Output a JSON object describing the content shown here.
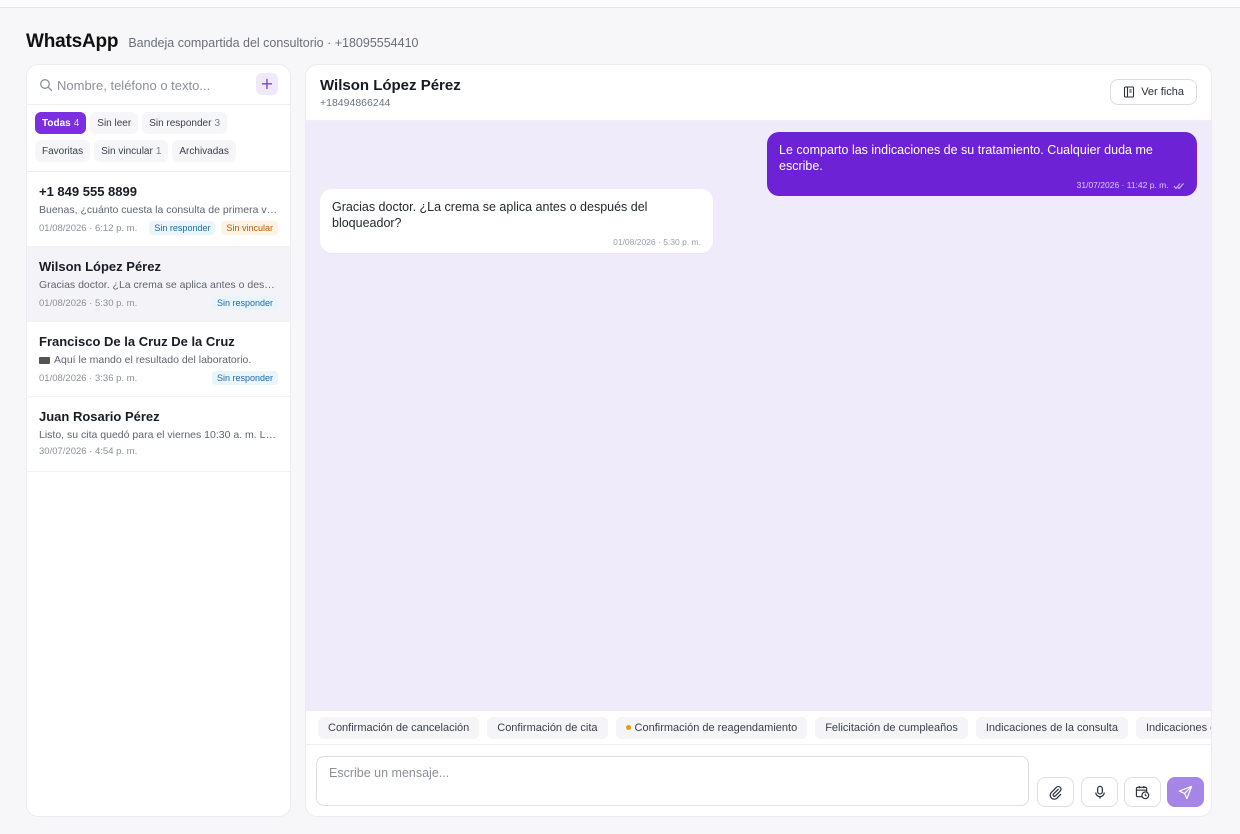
{
  "header": {
    "title": "WhatsApp",
    "subtitle": "Bandeja compartida del consultorio · +18095554410"
  },
  "sidebar": {
    "search_placeholder": "Nombre, teléfono o texto...",
    "add_label": "+",
    "filters": [
      {
        "label": "Todas",
        "count": "4",
        "active": true
      },
      {
        "label": "Sin leer",
        "count": ""
      },
      {
        "label": "Sin responder",
        "count": "3"
      },
      {
        "label": "Favoritas",
        "count": ""
      },
      {
        "label": "Sin vincular",
        "count": "1"
      },
      {
        "label": "Archivadas",
        "count": ""
      }
    ],
    "conversations": [
      {
        "name": "+1 849 555 8899",
        "preview": "Buenas, ¿cuánto cuesta la consulta de primera vez?",
        "time": "01/08/2026 · 6:12 p. m.",
        "badges": [
          "Sin responder",
          "Sin vincular"
        ]
      },
      {
        "name": "Wilson López Pérez",
        "preview": "Gracias doctor. ¿La crema se aplica antes o después del bloqueador?",
        "time": "01/08/2026 · 5:30 p. m.",
        "badges": [
          "Sin responder"
        ],
        "selected": true
      },
      {
        "name": "Francisco De la Cruz De la Cruz",
        "preview": "Aquí le mando el resultado del laboratorio.",
        "time": "01/08/2026 · 3:36 p. m.",
        "badges": [
          "Sin responder"
        ],
        "icon": "video-icon"
      },
      {
        "name": "Juan Rosario Pérez",
        "preview": "Listo, su cita quedó para el viernes 10:30 a. m. La e...",
        "time": "30/07/2026 · 4:54 p. m.",
        "badges": []
      }
    ]
  },
  "chat": {
    "contact_name": "Wilson López Pérez",
    "contact_phone": "+18494866244",
    "ver_ficha": "Ver ficha",
    "messages": [
      {
        "direction": "out",
        "text": "Le comparto las indicaciones de su tratamiento. Cualquier duda me escribe.",
        "time": "31/07/2026 · 11:42 p. m."
      },
      {
        "direction": "in",
        "text": "Gracias doctor. ¿La crema se aplica antes o después del bloqueador?",
        "time": "01/08/2026 · 5:30 p. m."
      }
    ],
    "quick_replies": [
      "Confirmación de cancelación",
      "Confirmación de cita",
      "Confirmación de reagendamiento",
      "Felicitación de cumpleaños",
      "Indicaciones de la consulta",
      "Indicaciones enviadas"
    ],
    "composer_placeholder": "Escribe un mensaje..."
  },
  "colors": {
    "accent": "#7b2fe0",
    "out_bubble": "#6e22d6",
    "chat_bg": "#efebfb",
    "badge_blue": "#1c6aa3",
    "badge_orange": "#b0600f",
    "dot_orange": "#e69a14"
  }
}
